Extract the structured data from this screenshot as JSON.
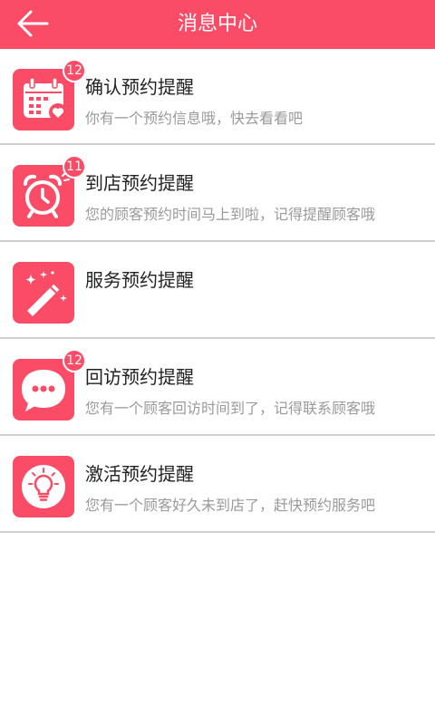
{
  "header": {
    "title": "消息中心",
    "back_icon": "arrow-left-icon"
  },
  "colors": {
    "accent": "#fb4c67",
    "divider": "#cfcfcf",
    "title_text": "#222222",
    "subtitle_text": "#9a9a9a"
  },
  "messages": [
    {
      "icon": "calendar-heart-icon",
      "title": "确认预约提醒",
      "subtitle": "你有一个预约信息哦，快去看看吧",
      "badge": "12"
    },
    {
      "icon": "alarm-clock-icon",
      "title": "到店预约提醒",
      "subtitle": "您的顾客预约时间马上到啦，记得提醒顾客哦",
      "badge": "11"
    },
    {
      "icon": "magic-wand-icon",
      "title": "服务预约提醒",
      "subtitle": "",
      "badge": ""
    },
    {
      "icon": "chat-bubble-icon",
      "title": "回访预约提醒",
      "subtitle": "您有一个顾客回访时间到了，记得联系顾客哦",
      "badge": "12"
    },
    {
      "icon": "lightbulb-icon",
      "title": "激活预约提醒",
      "subtitle": "您有一个顾客好久未到店了，赶快预约服务吧",
      "badge": ""
    }
  ]
}
